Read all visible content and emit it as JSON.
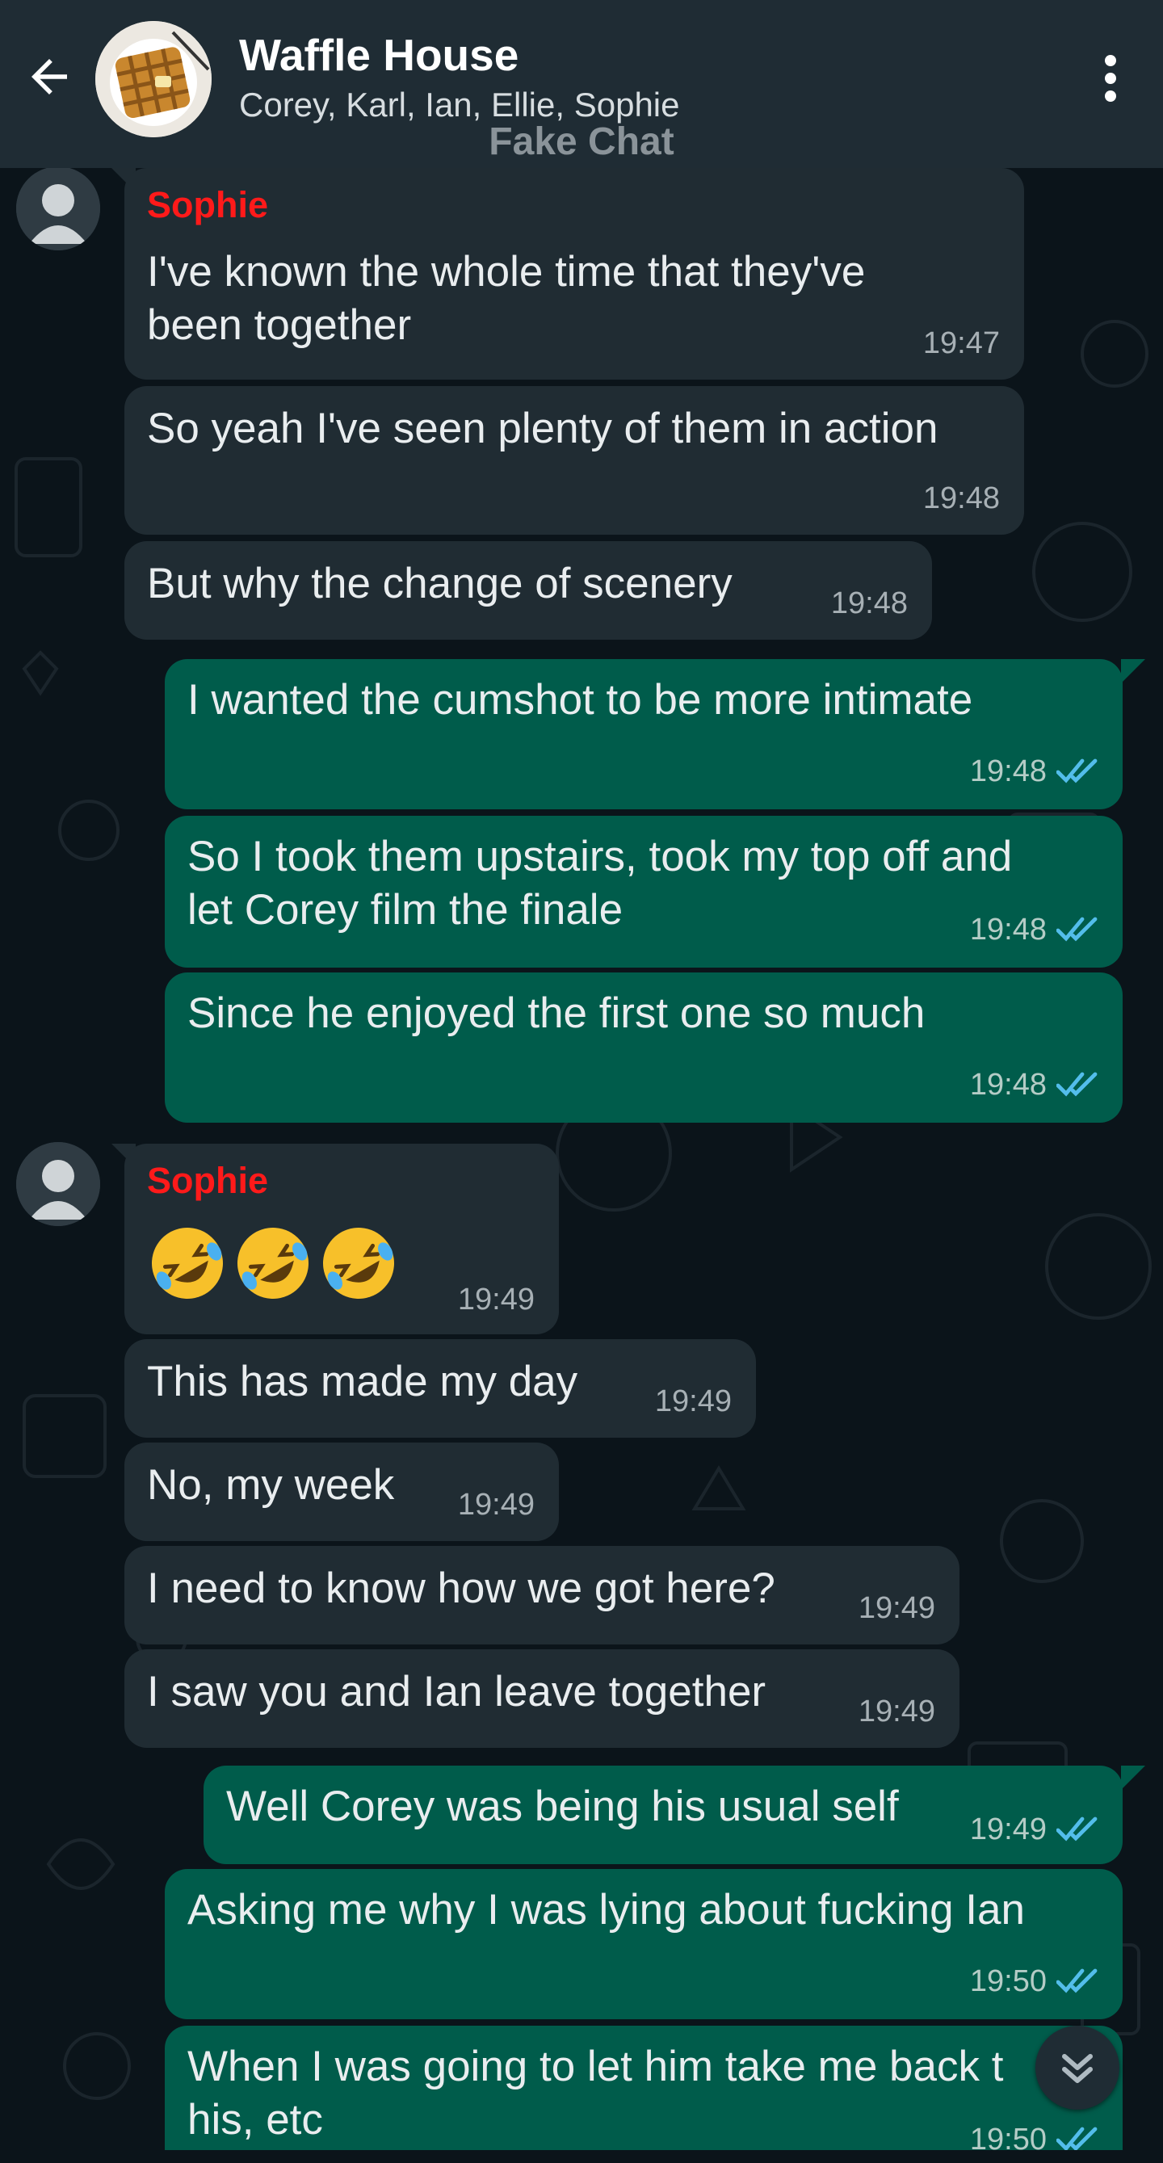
{
  "header": {
    "title": "Waffle House",
    "subtitle": "Corey, Karl, Ian, Ellie, Sophie",
    "watermark": "Fake Chat"
  },
  "messages": [
    {
      "sender": "Sophie",
      "lines": [
        "I've known the whole time that they've",
        "been together"
      ],
      "time": "19:47",
      "dir": "in"
    },
    {
      "lines": [
        "So yeah I've seen plenty of them in action"
      ],
      "time": "19:48",
      "dir": "in"
    },
    {
      "lines": [
        "But why the change of scenery"
      ],
      "time": "19:48",
      "dir": "in"
    },
    {
      "lines": [
        "I wanted the cumshot to be more intimate"
      ],
      "time": "19:48",
      "dir": "out"
    },
    {
      "lines": [
        "So I took them upstairs, took my top off and",
        "let Corey film the finale"
      ],
      "time": "19:48",
      "dir": "out"
    },
    {
      "lines": [
        "Since he enjoyed the first one so much"
      ],
      "time": "19:48",
      "dir": "out"
    },
    {
      "sender": "Sophie",
      "emoji": "rolling-on-floor-laughing x3",
      "time": "19:49",
      "dir": "in"
    },
    {
      "lines": [
        "This has made my day"
      ],
      "time": "19:49",
      "dir": "in"
    },
    {
      "lines": [
        "No, my week"
      ],
      "time": "19:49",
      "dir": "in"
    },
    {
      "lines": [
        "I need to know how we got here?"
      ],
      "time": "19:49",
      "dir": "in"
    },
    {
      "lines": [
        "I saw you and Ian leave together"
      ],
      "time": "19:49",
      "dir": "in"
    },
    {
      "lines": [
        "Well Corey was being his usual self"
      ],
      "time": "19:49",
      "dir": "out"
    },
    {
      "lines": [
        "Asking me why I was lying about fucking Ian"
      ],
      "time": "19:50",
      "dir": "out"
    },
    {
      "lines": [
        "When I was going to let him take me back t",
        "his, etc"
      ],
      "time": "19:50",
      "dir": "out"
    }
  ],
  "colors": {
    "incoming_bubble": "#202c33",
    "outgoing_bubble": "#005c4b",
    "sender_name": "#ff1a1a",
    "read_ticks": "#53bdeb",
    "header_bg": "#1f2c34"
  },
  "icons": {
    "back": "arrow-left-icon",
    "menu": "more-vertical-icon",
    "read_receipt": "double-check-icon",
    "scroll_down": "double-chevron-down-icon",
    "avatar": "default-person-icon"
  }
}
